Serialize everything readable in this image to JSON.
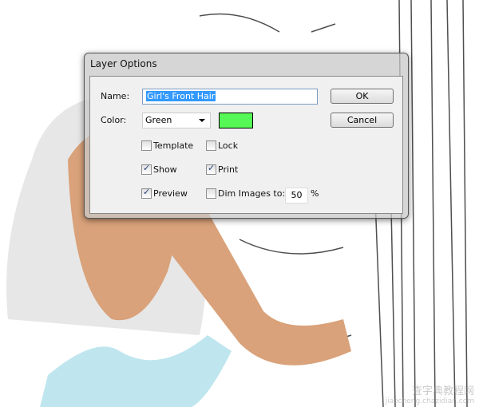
{
  "dialog": {
    "title": "Layer Options",
    "name_label": "Name:",
    "name_value": "Girl's Front Hair",
    "color_label": "Color:",
    "color_value": "Green",
    "color_swatch": "#55f855",
    "ok_label": "OK",
    "cancel_label": "Cancel",
    "checkboxes": [
      {
        "label": "Template",
        "checked": false
      },
      {
        "label": "Lock",
        "checked": false
      },
      {
        "label": "Show",
        "checked": true
      },
      {
        "label": "Print",
        "checked": true
      },
      {
        "label": "Preview",
        "checked": true
      },
      {
        "label": "Dim Images to:",
        "checked": false
      }
    ],
    "dim_value": "50",
    "dim_unit": "%"
  },
  "watermark": {
    "line1": "查字典教程网",
    "line2": "jiaocheng.chazidian.com"
  }
}
